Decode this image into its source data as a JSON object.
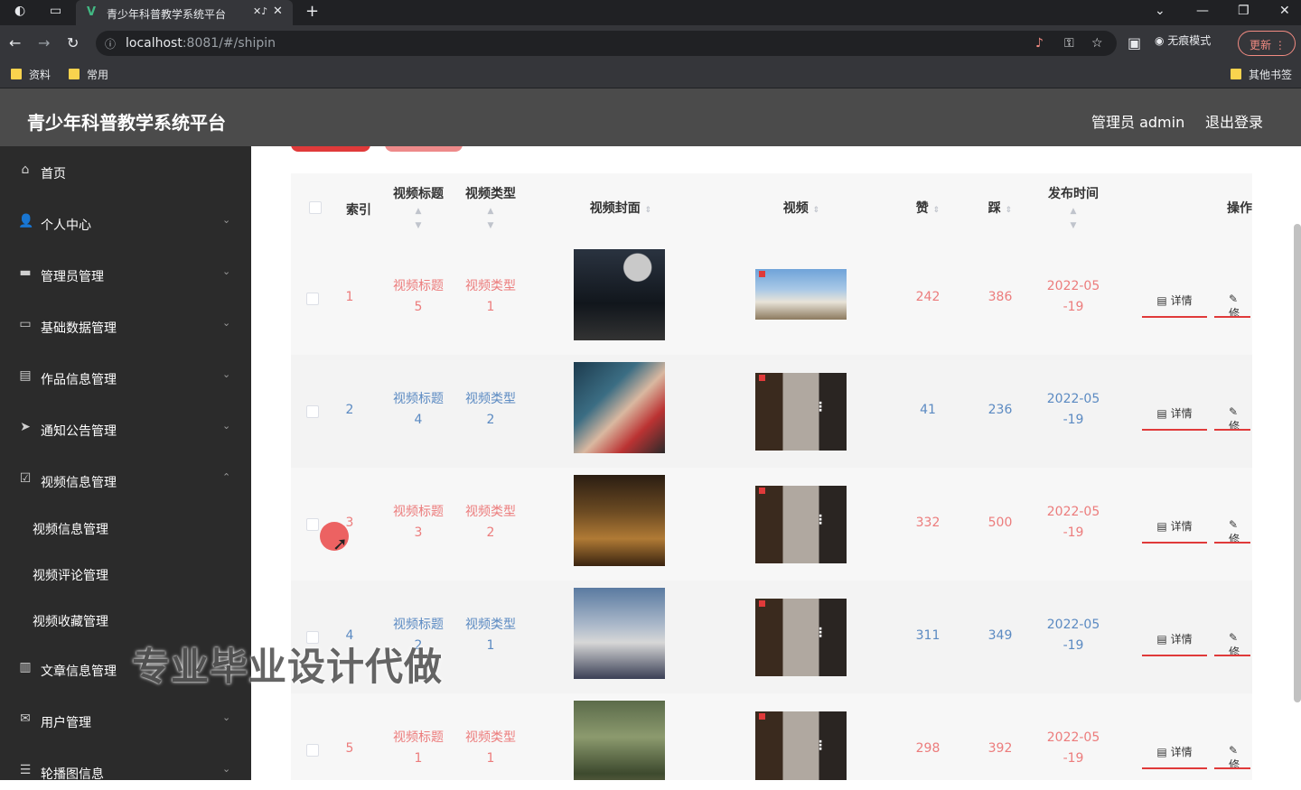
{
  "browser": {
    "tab_title": "青少年科普教学系统平台",
    "url_host": "localhost",
    "url_rest": ":8081/#/shipin",
    "incognito_label": "无痕模式",
    "update_label": "更新",
    "bookmarks": [
      "资料",
      "常用"
    ],
    "other_bookmarks": "其他书签"
  },
  "header": {
    "title": "青少年科普教学系统平台",
    "admin": "管理员 admin",
    "logout": "退出登录"
  },
  "sidebar": {
    "items": [
      {
        "label": "首页",
        "icon": "home-icon"
      },
      {
        "label": "个人中心",
        "icon": "user-icon"
      },
      {
        "label": "管理员管理",
        "icon": "briefcase-icon"
      },
      {
        "label": "基础数据管理",
        "icon": "monitor-icon"
      },
      {
        "label": "作品信息管理",
        "icon": "chat-icon"
      },
      {
        "label": "通知公告管理",
        "icon": "send-icon"
      },
      {
        "label": "视频信息管理",
        "icon": "clipboard-check-icon"
      },
      {
        "label": "文章信息管理",
        "icon": "document-icon"
      },
      {
        "label": "用户管理",
        "icon": "mail-icon"
      },
      {
        "label": "轮播图信息",
        "icon": "sliders-icon"
      }
    ],
    "subitems": [
      "视频信息管理",
      "视频评论管理",
      "视频收藏管理"
    ]
  },
  "table": {
    "headers": {
      "index": "索引",
      "title": "视频标题",
      "type": "视频类型",
      "cover": "视频封面",
      "video": "视频",
      "like": "赞",
      "dislike": "踩",
      "time": "发布时间",
      "ops": "操作"
    },
    "detail_label": "详情",
    "edit_label": "修",
    "rows": [
      {
        "index": "1",
        "title1": "视频标题",
        "title2": "5",
        "type1": "视频类型",
        "type2": "1",
        "like": "242",
        "dislike": "386",
        "time1": "2022-05",
        "time2": "-19",
        "color": "red"
      },
      {
        "index": "2",
        "title1": "视频标题",
        "title2": "4",
        "type1": "视频类型",
        "type2": "2",
        "like": "41",
        "dislike": "236",
        "time1": "2022-05",
        "time2": "-19",
        "color": "blue"
      },
      {
        "index": "3",
        "title1": "视频标题",
        "title2": "3",
        "type1": "视频类型",
        "type2": "2",
        "like": "332",
        "dislike": "500",
        "time1": "2022-05",
        "time2": "-19",
        "color": "red"
      },
      {
        "index": "4",
        "title1": "视频标题",
        "title2": "2",
        "type1": "视频类型",
        "type2": "1",
        "like": "311",
        "dislike": "349",
        "time1": "2022-05",
        "time2": "-19",
        "color": "blue"
      },
      {
        "index": "5",
        "title1": "视频标题",
        "title2": "1",
        "type1": "视频类型",
        "type2": "1",
        "like": "298",
        "dislike": "392",
        "time1": "2022-05",
        "time2": "-19",
        "color": "red"
      }
    ]
  },
  "watermark": "专业毕业设计代做",
  "colors": {
    "accent_red": "#e03a3a",
    "text_red": "#ec7c7c",
    "text_blue": "#5b8ac2",
    "header_bg": "#4b4b4b",
    "sidebar_bg": "#2b2b2b"
  }
}
